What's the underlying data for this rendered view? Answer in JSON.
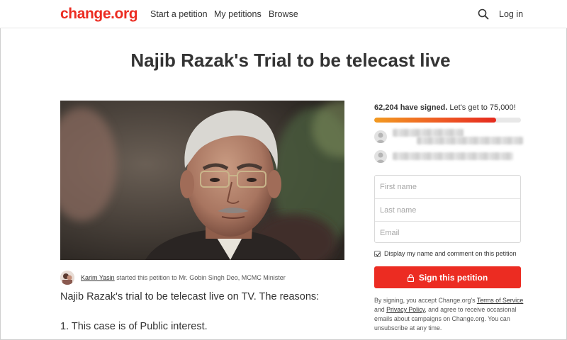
{
  "header": {
    "logo": "change.org",
    "nav": [
      "Start a petition",
      "My petitions",
      "Browse"
    ],
    "login": "Log in",
    "search_icon": "search-icon"
  },
  "petition": {
    "title": "Najib Razak's Trial to be telecast live",
    "starter": {
      "name": "Karim Yasin",
      "action": " started this petition to Mr. Gobin Singh Deo, MCMC Minister"
    },
    "body": [
      "Najib Razak's trial to be telecast live on TV. The reasons:",
      "1. This case is of Public interest."
    ]
  },
  "sidebar": {
    "signed_count": "62,204 have signed.",
    "goal_text": " Let's get to 75,000!",
    "progress_fraction": 0.8294,
    "form": {
      "first_name_placeholder": "First name",
      "last_name_placeholder": "Last name",
      "email_placeholder": "Email"
    },
    "display_label": "Display my name and comment on this petition",
    "display_checked": true,
    "sign_button": "Sign this petition",
    "terms": {
      "t1": "By signing, you accept Change.org's ",
      "link1": "Terms of Service",
      "t2": " and ",
      "link2": "Privacy Policy",
      "t3": ", and agree to receive occasional emails about campaigns on Change.org. You can unsubscribe at any time."
    }
  },
  "colors": {
    "brand": "#ec2c22",
    "progress_start": "#f29a21",
    "text": "#333333"
  }
}
